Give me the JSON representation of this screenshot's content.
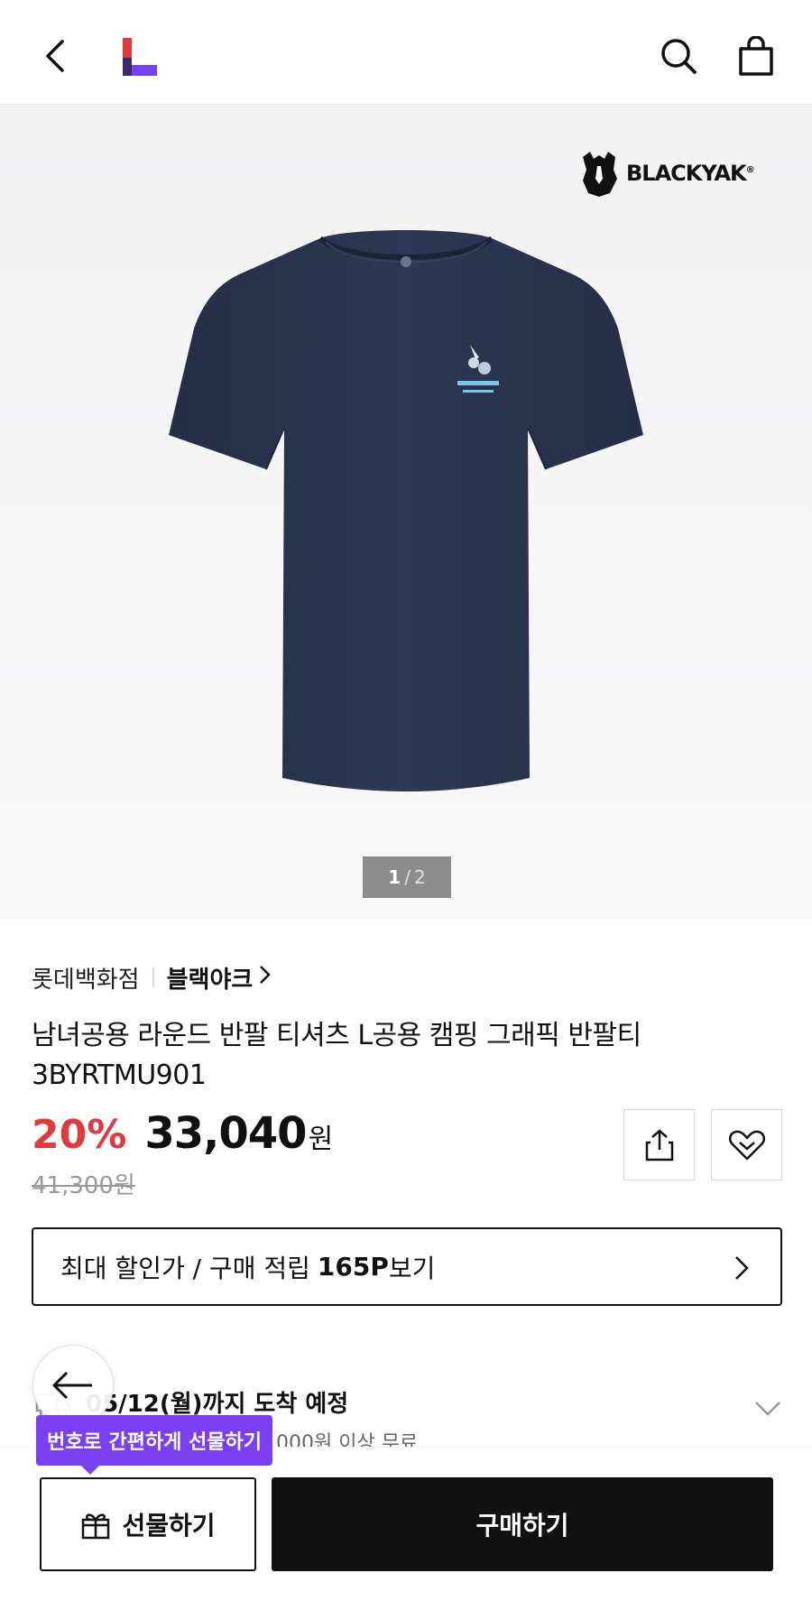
{
  "header": {
    "back_icon": "chevron-left-icon",
    "logo": "lotteon-logo",
    "search_icon": "search-icon",
    "cart_icon": "shopping-bag-icon"
  },
  "gallery": {
    "brand_logo_text": "BLACKYAK",
    "brand_logo_reg": "®",
    "current": "1",
    "separator": "/",
    "total": "2",
    "shirt_color": "#2a3550"
  },
  "product": {
    "store": "롯데백화점",
    "brand": "블랙야크",
    "title": "남녀공용 라운드 반팔 티셔츠 L공용 캠핑 그래픽 반팔티 3BYRTMU901",
    "discount": "20%",
    "price": "33,040",
    "currency": "원",
    "original_price": "41,300원"
  },
  "actions": {
    "share_icon": "share-icon",
    "wishlist_icon": "heart-icon"
  },
  "benefit": {
    "label": "최대 할인가 / 구매 적립",
    "points": "165P",
    "suffix": "보기"
  },
  "delivery": {
    "date_text": "05/12(월)까지 도착 예정",
    "sub_text": "0,000원 이상 무료"
  },
  "bottom": {
    "tooltip": "번호로 간편하게 선물하기",
    "gift_label": "선물하기",
    "buy_label": "구매하기"
  },
  "colors": {
    "accent_red": "#e2393f",
    "accent_purple": "#7a3ff0",
    "primary_black": "#111111"
  }
}
